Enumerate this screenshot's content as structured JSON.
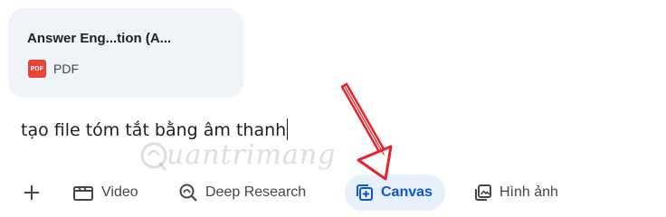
{
  "attachment": {
    "title": "Answer Eng...tion (A...",
    "badge": "PDF",
    "type_label": "PDF"
  },
  "prompt": {
    "text": "tạo file tóm tắt bằng âm thanh"
  },
  "watermark": {
    "text": "uantrimang"
  },
  "toolbar": {
    "video_label": "Video",
    "deep_research_label": "Deep Research",
    "canvas_label": "Canvas",
    "image_label": "Hình ảnh"
  },
  "colors": {
    "card_bg": "#f0f4f9",
    "canvas_active_bg": "#e8f0fe",
    "canvas_active_text": "#0b57d0",
    "pdf_red": "#e94335",
    "arrow_red": "#e8212a"
  },
  "icons": [
    "pdf-icon",
    "add-icon",
    "video-icon",
    "deep-research-icon",
    "canvas-icon",
    "image-icon",
    "watermark-logo-icon",
    "red-arrow-annotation"
  ]
}
